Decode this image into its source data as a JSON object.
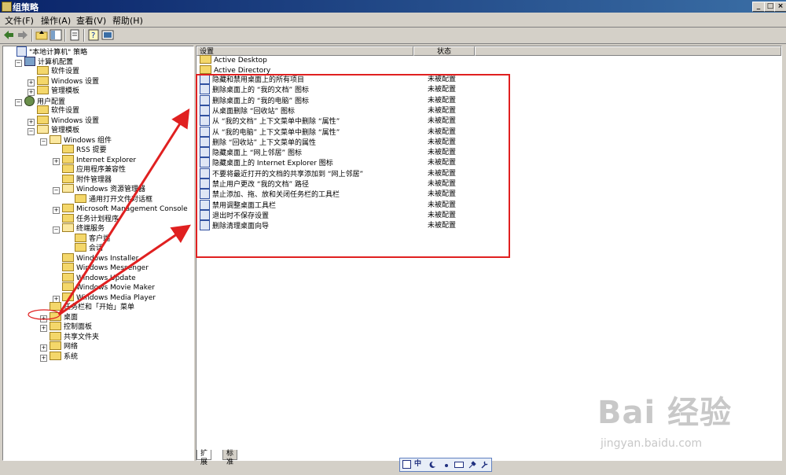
{
  "window": {
    "title": "组策略",
    "min": "_",
    "max": "□",
    "close": "×"
  },
  "menu": [
    "文件(F)",
    "操作(A)",
    "查看(V)",
    "帮助(H)"
  ],
  "tree": [
    {
      "label": "\"本地计算机\" 策略",
      "level": 0,
      "icon": "policy-icon",
      "expander": ""
    },
    {
      "label": "计算机配置",
      "level": 1,
      "icon": "computer-icon",
      "expander": "−"
    },
    {
      "label": "软件设置",
      "level": 2,
      "icon": "folder-icon",
      "expander": ""
    },
    {
      "label": "Windows 设置",
      "level": 2,
      "icon": "folder-icon",
      "expander": "+"
    },
    {
      "label": "管理模板",
      "level": 2,
      "icon": "folder-icon",
      "expander": "+"
    },
    {
      "label": "用户配置",
      "level": 1,
      "icon": "user-icon",
      "expander": "−"
    },
    {
      "label": "软件设置",
      "level": 2,
      "icon": "folder-icon",
      "expander": ""
    },
    {
      "label": "Windows 设置",
      "level": 2,
      "icon": "folder-icon",
      "expander": "+"
    },
    {
      "label": "管理模板",
      "level": 2,
      "icon": "folder-open-icon",
      "expander": "−"
    },
    {
      "label": "Windows 组件",
      "level": 3,
      "icon": "folder-open-icon",
      "expander": "−"
    },
    {
      "label": "RSS 提要",
      "level": 4,
      "icon": "folder-icon",
      "expander": ""
    },
    {
      "label": "Internet Explorer",
      "level": 4,
      "icon": "folder-icon",
      "expander": "+"
    },
    {
      "label": "应用程序兼容性",
      "level": 4,
      "icon": "folder-icon",
      "expander": ""
    },
    {
      "label": "附件管理器",
      "level": 4,
      "icon": "folder-icon",
      "expander": ""
    },
    {
      "label": "Windows 资源管理器",
      "level": 4,
      "icon": "folder-open-icon",
      "expander": "−"
    },
    {
      "label": "通用打开文件对话框",
      "level": 5,
      "icon": "folder-icon",
      "expander": ""
    },
    {
      "label": "Microsoft Management Console",
      "level": 4,
      "icon": "folder-icon",
      "expander": "+"
    },
    {
      "label": "任务计划程序",
      "level": 4,
      "icon": "folder-icon",
      "expander": ""
    },
    {
      "label": "终端服务",
      "level": 4,
      "icon": "folder-open-icon",
      "expander": "−"
    },
    {
      "label": "客户端",
      "level": 5,
      "icon": "folder-icon",
      "expander": ""
    },
    {
      "label": "会话",
      "level": 5,
      "icon": "folder-icon",
      "expander": ""
    },
    {
      "label": "Windows Installer",
      "level": 4,
      "icon": "folder-icon",
      "expander": ""
    },
    {
      "label": "Windows Messenger",
      "level": 4,
      "icon": "folder-icon",
      "expander": ""
    },
    {
      "label": "Windows Update",
      "level": 4,
      "icon": "folder-icon",
      "expander": ""
    },
    {
      "label": "Windows Movie Maker",
      "level": 4,
      "icon": "folder-icon",
      "expander": ""
    },
    {
      "label": "Windows Media Player",
      "level": 4,
      "icon": "folder-icon",
      "expander": "+"
    },
    {
      "label": "任务栏和「开始」菜单",
      "level": 3,
      "icon": "folder-icon",
      "expander": ""
    },
    {
      "label": "桌面",
      "level": 3,
      "icon": "folder-icon",
      "expander": "+",
      "selected": true
    },
    {
      "label": "控制面板",
      "level": 3,
      "icon": "folder-icon",
      "expander": "+"
    },
    {
      "label": "共享文件夹",
      "level": 3,
      "icon": "folder-icon",
      "expander": ""
    },
    {
      "label": "网络",
      "level": 3,
      "icon": "folder-icon",
      "expander": "+"
    },
    {
      "label": "系统",
      "level": 3,
      "icon": "folder-icon",
      "expander": "+"
    }
  ],
  "list": {
    "columns": [
      "设置",
      "状态"
    ],
    "folders": [
      "Active Desktop",
      "Active Directory"
    ],
    "items": [
      {
        "name": "隐藏和禁用桌面上的所有项目",
        "state": "未被配置"
      },
      {
        "name": "删除桌面上的 “我的文档” 图标",
        "state": "未被配置"
      },
      {
        "name": "删除桌面上的 “我的电脑” 图标",
        "state": "未被配置"
      },
      {
        "name": "从桌面删除 “回收站” 图标",
        "state": "未被配置"
      },
      {
        "name": "从 “我的文档” 上下文菜单中删除 “属性”",
        "state": "未被配置"
      },
      {
        "name": "从 “我的电脑” 上下文菜单中删除 “属性”",
        "state": "未被配置"
      },
      {
        "name": "删除 “回收站” 上下文菜单的属性",
        "state": "未被配置"
      },
      {
        "name": "隐藏桌面上 “网上邻居” 图标",
        "state": "未被配置"
      },
      {
        "name": "隐藏桌面上的 Internet Explorer 图标",
        "state": "未被配置"
      },
      {
        "name": "不要将最近打开的文档的共享添加到 “网上邻居”",
        "state": "未被配置"
      },
      {
        "name": "禁止用户更改 “我的文档” 路径",
        "state": "未被配置"
      },
      {
        "name": "禁止添加、拖、放和关闭任务栏的工具栏",
        "state": "未被配置"
      },
      {
        "name": "禁用调整桌面工具栏",
        "state": "未被配置"
      },
      {
        "name": "退出时不保存设置",
        "state": "未被配置"
      },
      {
        "name": "删除清理桌面向导",
        "state": "未被配置"
      }
    ]
  },
  "tabs": [
    "扩展",
    "标准"
  ],
  "ime": {
    "mode": "中",
    "icons": [
      "moon-icon",
      "dot-icon",
      "keyboard-icon",
      "tool-icon"
    ]
  },
  "watermark": {
    "line1": "Bai 经验",
    "line2": "jingyan.baidu.com"
  },
  "colors": {
    "highlight": "#e02020",
    "titlebar": "#0a246a"
  }
}
